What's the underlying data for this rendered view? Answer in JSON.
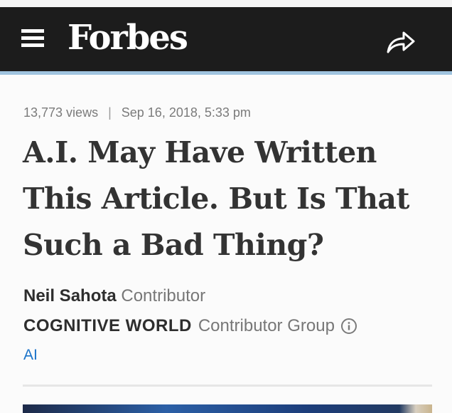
{
  "header": {
    "logo_text": "Forbes",
    "menu_icon": "hamburger-menu-icon",
    "share_icon": "share-arrow-icon",
    "background_color": "#1c1c1c",
    "accent_color": "#9fc3de"
  },
  "article": {
    "views": "13,773 views",
    "separator": "|",
    "date": "Sep 16, 2018, 5:33 pm",
    "headline_lines": [
      "A.I. May Have Written",
      "This Article. But Is That",
      "Such a Bad Thing?"
    ],
    "author": {
      "name": "Neil Sahota",
      "role": "Contributor"
    },
    "group": {
      "name": "COGNITIVE WORLD",
      "role": "Contributor Group",
      "info_icon": "info-circle-icon"
    },
    "tag": "AI",
    "tag_color": "#1a73c9"
  }
}
